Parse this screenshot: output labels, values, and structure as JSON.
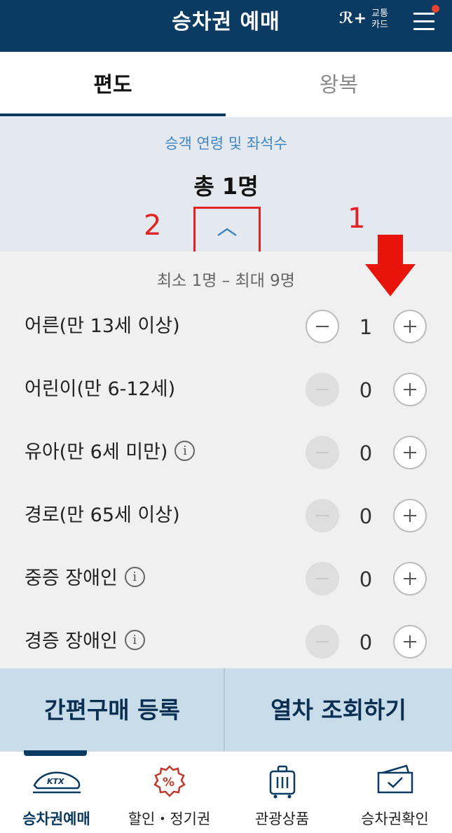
{
  "header": {
    "title": "승차권 예매",
    "traffic_card_logo": "ℛ+",
    "traffic_card_line1": "교통",
    "traffic_card_line2": "카드",
    "menu_icon": "hamburger-menu-icon",
    "notification_dot_color": "#e8432e"
  },
  "tabs": [
    {
      "label": "편도",
      "active": true
    },
    {
      "label": "왕복",
      "active": false
    }
  ],
  "summary": {
    "label": "승객 연령 및 좌석수",
    "total": "총 1명",
    "collapse_icon": "chevron-up-icon"
  },
  "annotations": {
    "box_number": "2",
    "arrow_number": "1",
    "color": "#e02424"
  },
  "passengers": {
    "range": "최소 1명 – 최대 9명",
    "rows": [
      {
        "label": "어른(만 13세 이상)",
        "count": "1",
        "info": false,
        "minus_enabled": true
      },
      {
        "label": "어린이(만 6-12세)",
        "count": "0",
        "info": false,
        "minus_enabled": false
      },
      {
        "label": "유아(만 6세 미만)",
        "count": "0",
        "info": true,
        "minus_enabled": false
      },
      {
        "label": "경로(만 65세 이상)",
        "count": "0",
        "info": false,
        "minus_enabled": false
      },
      {
        "label": "중증 장애인",
        "count": "0",
        "info": true,
        "minus_enabled": false
      },
      {
        "label": "경증 장애인",
        "count": "0",
        "info": true,
        "minus_enabled": false
      }
    ]
  },
  "actions": {
    "register": "간편구매 등록",
    "search": "열차 조회하기"
  },
  "bottom_nav": [
    {
      "label": "승차권예매",
      "icon": "ktx-train-icon",
      "active": true
    },
    {
      "label": "할인・정기권",
      "icon": "discount-badge-icon",
      "active": false
    },
    {
      "label": "관광상품",
      "icon": "suitcase-icon",
      "active": false
    },
    {
      "label": "승차권확인",
      "icon": "ticket-check-icon",
      "active": false
    }
  ],
  "colors": {
    "primary": "#0b3a63",
    "accent_text": "#3f86c3",
    "summary_bg": "#e3e9ef",
    "list_bg": "#f0f0f0",
    "action_bg": "#c9dcea",
    "discount_icon": "#c0392b"
  }
}
